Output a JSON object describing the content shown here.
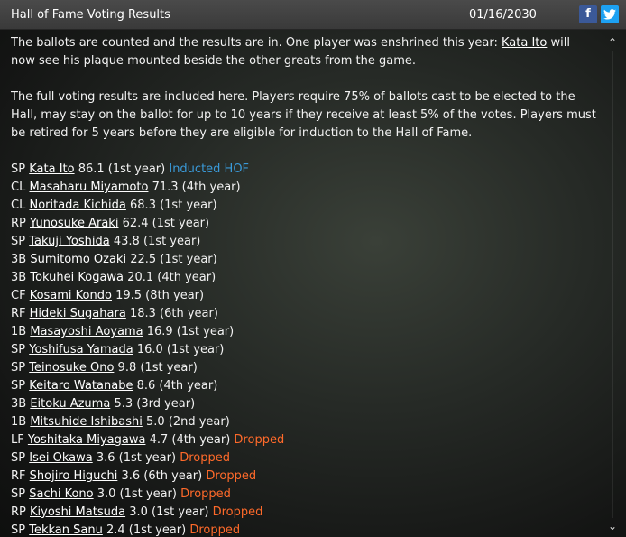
{
  "header": {
    "title": "Hall of Fame Voting Results",
    "date": "01/16/2030",
    "facebook_icon": "f",
    "twitter_icon": "twitter-bird"
  },
  "intro": {
    "p1_before": "The ballots are counted and the results are in. One player was enshrined this year: ",
    "p1_link": "Kata Ito",
    "p1_after": " will now see his plaque mounted beside the other greats from the game.",
    "p2": "The full voting results are included here. Players require 75% of ballots cast to be elected to the Hall, may stay on the ballot for up to 10 years if they receive at least 5% of the votes. Players must be retired for 5 years before they are eligible for induction to the Hall of Fame."
  },
  "results": [
    {
      "pos": "SP",
      "name": "Kata Ito",
      "stats": "86.1 (1st year)",
      "status": "Inducted HOF",
      "status_type": "hof"
    },
    {
      "pos": "CL",
      "name": "Masaharu Miyamoto",
      "stats": "71.3 (4th year)",
      "status": "",
      "status_type": ""
    },
    {
      "pos": "CL",
      "name": "Noritada Kichida",
      "stats": "68.3 (1st year)",
      "status": "",
      "status_type": ""
    },
    {
      "pos": "RP",
      "name": "Yunosuke Araki",
      "stats": "62.4 (1st year)",
      "status": "",
      "status_type": ""
    },
    {
      "pos": "SP",
      "name": "Takuji Yoshida",
      "stats": "43.8 (1st year)",
      "status": "",
      "status_type": ""
    },
    {
      "pos": "3B",
      "name": "Sumitomo Ozaki",
      "stats": "22.5 (1st year)",
      "status": "",
      "status_type": ""
    },
    {
      "pos": "3B",
      "name": "Tokuhei Kogawa",
      "stats": "20.1 (4th year)",
      "status": "",
      "status_type": ""
    },
    {
      "pos": "CF",
      "name": "Kosami Kondo",
      "stats": "19.5 (8th year)",
      "status": "",
      "status_type": ""
    },
    {
      "pos": "RF",
      "name": "Hideki Sugahara",
      "stats": "18.3 (6th year)",
      "status": "",
      "status_type": ""
    },
    {
      "pos": "1B",
      "name": "Masayoshi Aoyama",
      "stats": "16.9 (1st year)",
      "status": "",
      "status_type": ""
    },
    {
      "pos": "SP",
      "name": "Yoshifusa Yamada",
      "stats": "16.0 (1st year)",
      "status": "",
      "status_type": ""
    },
    {
      "pos": "SP",
      "name": "Teinosuke Ono",
      "stats": "9.8 (1st year)",
      "status": "",
      "status_type": ""
    },
    {
      "pos": "SP",
      "name": "Keitaro Watanabe",
      "stats": "8.6 (4th year)",
      "status": "",
      "status_type": ""
    },
    {
      "pos": "3B",
      "name": "Eitoku Azuma",
      "stats": "5.3 (3rd year)",
      "status": "",
      "status_type": ""
    },
    {
      "pos": "1B",
      "name": "Mitsuhide Ishibashi",
      "stats": "5.0 (2nd year)",
      "status": "",
      "status_type": ""
    },
    {
      "pos": "LF",
      "name": "Yoshitaka Miyagawa",
      "stats": "4.7 (4th year)",
      "status": "Dropped",
      "status_type": "drop"
    },
    {
      "pos": "SP",
      "name": "Isei Okawa",
      "stats": "3.6 (1st year)",
      "status": "Dropped",
      "status_type": "drop"
    },
    {
      "pos": "RF",
      "name": "Shojiro Higuchi",
      "stats": "3.6 (6th year)",
      "status": "Dropped",
      "status_type": "drop"
    },
    {
      "pos": "SP",
      "name": "Sachi Kono",
      "stats": "3.0 (1st year)",
      "status": "Dropped",
      "status_type": "drop"
    },
    {
      "pos": "RP",
      "name": "Kiyoshi Matsuda",
      "stats": "3.0 (1st year)",
      "status": "Dropped",
      "status_type": "drop"
    },
    {
      "pos": "SP",
      "name": "Tekkan Sanu",
      "stats": "2.4 (1st year)",
      "status": "Dropped",
      "status_type": "drop"
    }
  ],
  "colors": {
    "hof": "#3a9ad9",
    "dropped": "#ff6a2a",
    "titlebar": "#404040"
  }
}
